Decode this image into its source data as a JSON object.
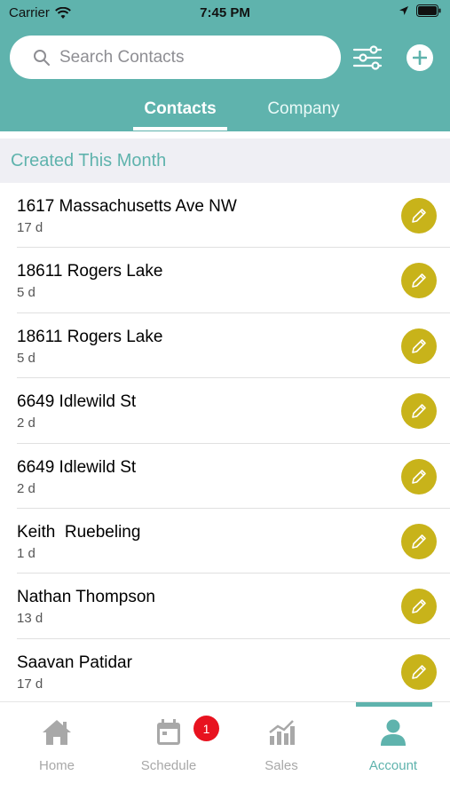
{
  "status_bar": {
    "carrier": "Carrier",
    "time": "7:45 PM"
  },
  "search": {
    "placeholder": "Search Contacts"
  },
  "tabs": [
    {
      "label": "Contacts",
      "active": true
    },
    {
      "label": "Company",
      "active": false
    }
  ],
  "section": {
    "title": "Created This Month"
  },
  "contacts": [
    {
      "name": "1617 Massachusetts Ave NW",
      "age": "17 d"
    },
    {
      "name": "18611 Rogers Lake",
      "age": "5 d"
    },
    {
      "name": "18611 Rogers Lake",
      "age": "5 d"
    },
    {
      "name": "6649 Idlewild St",
      "age": "2 d"
    },
    {
      "name": "6649 Idlewild St",
      "age": "2 d"
    },
    {
      "name": "Keith  Ruebeling",
      "age": "1 d"
    },
    {
      "name": "Nathan Thompson",
      "age": "13 d"
    },
    {
      "name": "Saavan Patidar",
      "age": "17 d"
    }
  ],
  "tabbar": {
    "items": [
      {
        "label": "Home",
        "icon": "home-icon",
        "active": false
      },
      {
        "label": "Schedule",
        "icon": "calendar-icon",
        "active": false
      },
      {
        "label": "Sales",
        "icon": "chart-icon",
        "active": false
      },
      {
        "label": "Account",
        "icon": "user-icon",
        "active": true
      }
    ],
    "schedule_badge": "1"
  },
  "colors": {
    "accent": "#5fb3ad",
    "edit_button": "#c8b31a",
    "badge": "#e8121f"
  }
}
